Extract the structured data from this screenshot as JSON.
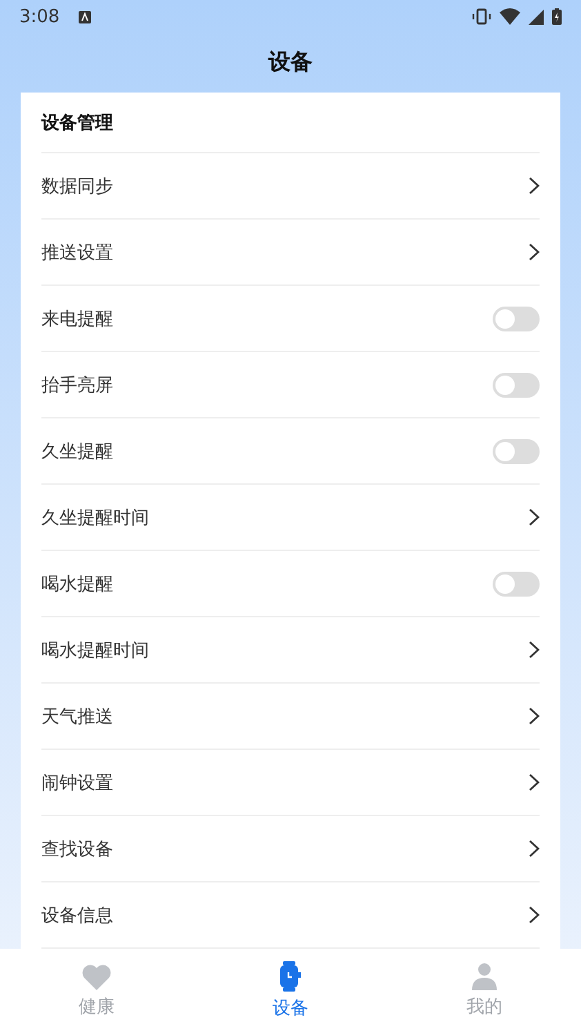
{
  "status_bar": {
    "time": "3:08"
  },
  "header": {
    "title": "设备"
  },
  "card": {
    "title": "设备管理",
    "items": [
      {
        "label": "数据同步",
        "kind": "link"
      },
      {
        "label": "推送设置",
        "kind": "link"
      },
      {
        "label": "来电提醒",
        "kind": "toggle",
        "on": false
      },
      {
        "label": "抬手亮屏",
        "kind": "toggle",
        "on": false
      },
      {
        "label": "久坐提醒",
        "kind": "toggle",
        "on": false
      },
      {
        "label": "久坐提醒时间",
        "kind": "link"
      },
      {
        "label": "喝水提醒",
        "kind": "toggle",
        "on": false
      },
      {
        "label": "喝水提醒时间",
        "kind": "link"
      },
      {
        "label": "天气推送",
        "kind": "link"
      },
      {
        "label": "闹钟设置",
        "kind": "link"
      },
      {
        "label": "查找设备",
        "kind": "link"
      },
      {
        "label": "设备信息",
        "kind": "link"
      }
    ]
  },
  "tabs": [
    {
      "label": "健康",
      "kind": "heart",
      "selected": false
    },
    {
      "label": "设备",
      "kind": "watch",
      "selected": true
    },
    {
      "label": "我的",
      "kind": "person",
      "selected": false
    }
  ]
}
